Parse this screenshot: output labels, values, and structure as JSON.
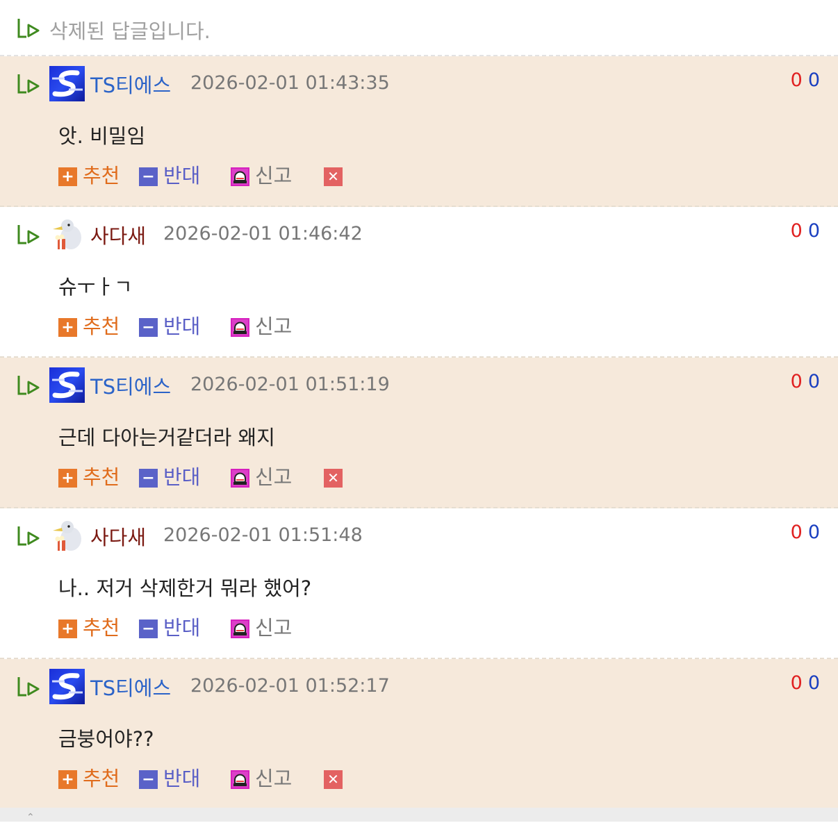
{
  "deleted_reply": {
    "text": "삭제된 답글입니다."
  },
  "actions": {
    "recommend_label": "추천",
    "oppose_label": "반대",
    "report_label": "신고",
    "recommend_icon": "plus-icon",
    "oppose_icon": "minus-icon",
    "report_icon": "siren-icon",
    "delete_icon": "close-icon"
  },
  "colors": {
    "highlight_bg": "#f6e9db",
    "author_blue": "#2b63c8",
    "author_red": "#7b1a12",
    "vote_up": "#e02020",
    "vote_down": "#1a3fc0"
  },
  "comments": [
    {
      "author": "TS티에스",
      "datetime": "2026-02-01 01:43:35",
      "body": "앗. 비밀임",
      "votes_up": "0",
      "votes_down": "0",
      "avatar": "ts-logo-avatar"
    },
    {
      "author": "사다새",
      "datetime": "2026-02-01 01:46:42",
      "body": "슈ㅜㅏㄱ",
      "votes_up": "0",
      "votes_down": "0",
      "avatar": "pelican-popcorn-avatar"
    },
    {
      "author": "TS티에스",
      "datetime": "2026-02-01 01:51:19",
      "body": "근데 다아는거같더라 왜지",
      "votes_up": "0",
      "votes_down": "0",
      "avatar": "ts-logo-avatar"
    },
    {
      "author": "사다새",
      "datetime": "2026-02-01 01:51:48",
      "body": "나.. 저거 삭제한거 뭐라 했어?",
      "votes_up": "0",
      "votes_down": "0",
      "avatar": "pelican-popcorn-avatar"
    },
    {
      "author": "TS티에스",
      "datetime": "2026-02-01 01:52:17",
      "body": "금붕어야??",
      "votes_up": "0",
      "votes_down": "0",
      "avatar": "ts-logo-avatar"
    }
  ]
}
